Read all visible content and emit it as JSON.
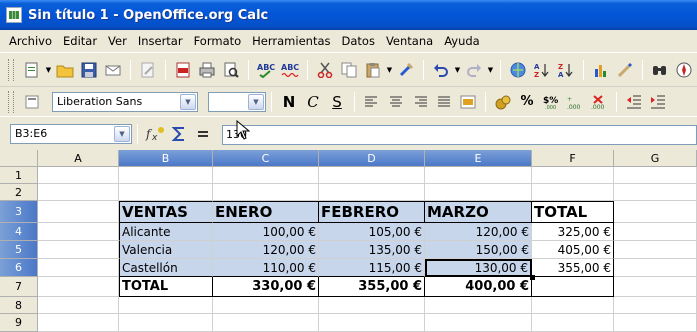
{
  "window": {
    "title": "Sin título 1 - OpenOffice.org Calc"
  },
  "menu": {
    "items": [
      {
        "label": "Archivo"
      },
      {
        "label": "Editar"
      },
      {
        "label": "Ver"
      },
      {
        "label": "Insertar"
      },
      {
        "label": "Formato"
      },
      {
        "label": "Herramientas"
      },
      {
        "label": "Datos"
      },
      {
        "label": "Ventana"
      },
      {
        "label": "Ayuda"
      }
    ]
  },
  "formatting": {
    "font_name": "Liberation Sans",
    "font_size": "",
    "bold": "N",
    "italic": "C",
    "underline": "S"
  },
  "formula_bar": {
    "name_box": "B3:E6",
    "content": "130"
  },
  "columns": [
    "A",
    "B",
    "C",
    "D",
    "E",
    "F",
    "G"
  ],
  "rows": [
    "1",
    "2",
    "3",
    "4",
    "5",
    "6",
    "7",
    "8",
    "9"
  ],
  "table": {
    "header": [
      "VENTAS",
      "ENERO",
      "FEBRERO",
      "MARZO",
      "TOTAL"
    ],
    "rows": [
      [
        "Alicante",
        "100,00 €",
        "105,00 €",
        "120,00 €",
        "325,00 €"
      ],
      [
        "Valencia",
        "120,00 €",
        "135,00 €",
        "150,00 €",
        "405,00 €"
      ],
      [
        "Castellón",
        "110,00 €",
        "115,00 €",
        "130,00 €",
        "355,00 €"
      ]
    ],
    "totals": [
      "TOTAL",
      "330,00 €",
      "355,00 €",
      "400,00 €",
      ""
    ]
  },
  "colors": {
    "title_bar": "#0355d8",
    "selection": "#c8d6ec",
    "header_selected": "#4b78c8"
  }
}
